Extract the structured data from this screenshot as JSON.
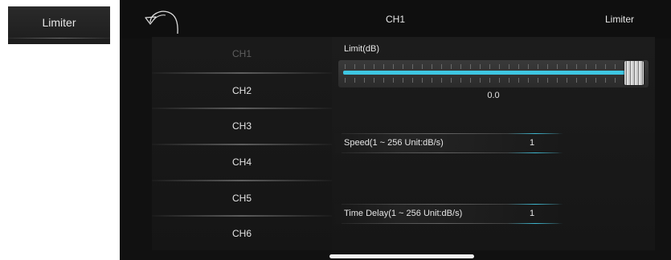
{
  "thumbnail": {
    "label": "Limiter"
  },
  "header": {
    "back_icon": "curved-back-arrow-icon",
    "title": "CH1",
    "right_label": "Limiter"
  },
  "channels": {
    "items": [
      {
        "label": "CH1",
        "active": true
      },
      {
        "label": "CH2",
        "active": false
      },
      {
        "label": "CH3",
        "active": false
      },
      {
        "label": "CH4",
        "active": false
      },
      {
        "label": "CH5",
        "active": false
      },
      {
        "label": "CH6",
        "active": false
      }
    ]
  },
  "limit": {
    "label": "Limit(dB)",
    "value": "0.0",
    "slider_fraction": 1.0
  },
  "speed": {
    "label": "Speed(1 ~ 256 Unit:dB/s)",
    "value": "1"
  },
  "time_delay": {
    "label": "Time Delay(1 ~ 256 Unit:dB/s)",
    "value": "1"
  },
  "colors": {
    "accent": "#3ec6e2",
    "panel_bg": "#111111",
    "active_channel_text": "#5f5f5f"
  }
}
